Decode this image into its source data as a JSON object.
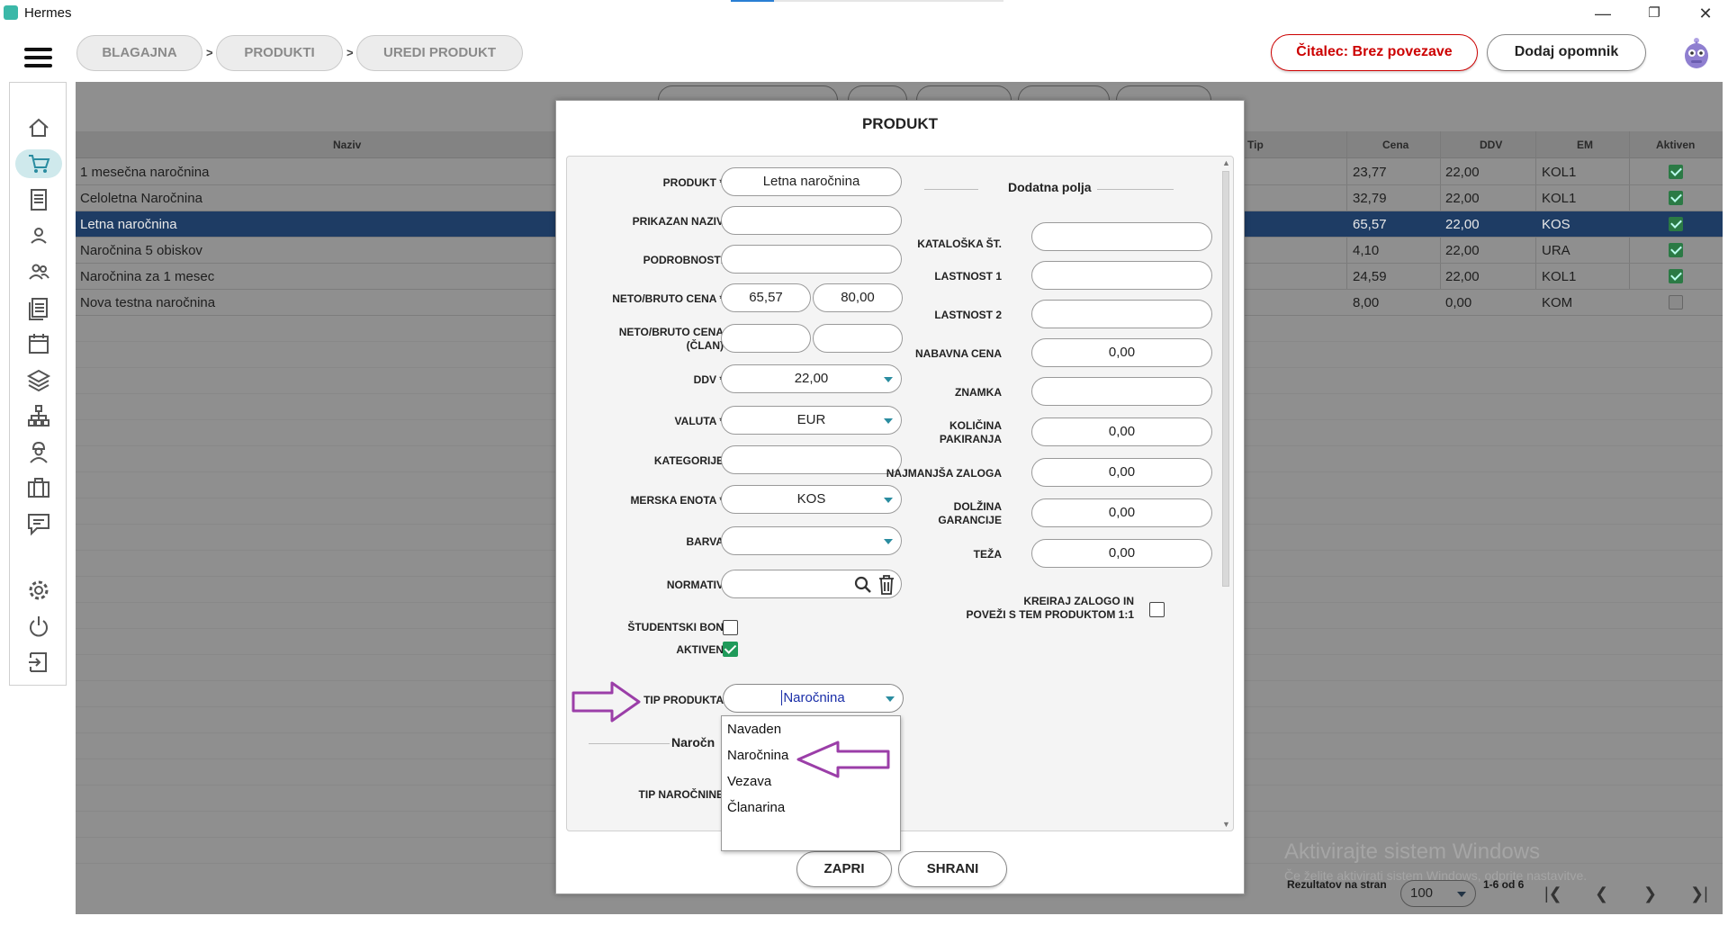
{
  "window": {
    "title": "Hermes",
    "progress_fraction": 0.16
  },
  "breadcrumb": [
    {
      "label": "BLAGAJNA"
    },
    {
      "label": "PRODUKTI"
    },
    {
      "label": "UREDI PRODUKT"
    }
  ],
  "breadcrumb_sep": ">",
  "header": {
    "reader_status": "Čitalec: Brez povezave",
    "reader_color": "#cc0000",
    "add_reminder": "Dodaj opomnik"
  },
  "sidebar": {
    "items": [
      {
        "icon": "home-icon"
      },
      {
        "icon": "cart-icon",
        "active": true
      },
      {
        "icon": "document-icon"
      },
      {
        "icon": "user-icon"
      },
      {
        "icon": "users-icon"
      },
      {
        "icon": "list-icon"
      },
      {
        "icon": "calendar-icon"
      },
      {
        "icon": "layers-icon"
      },
      {
        "icon": "network-icon"
      },
      {
        "icon": "worker-icon"
      },
      {
        "icon": "briefcase-icon"
      },
      {
        "icon": "chat-icon"
      },
      {
        "icon": "gear-icon"
      },
      {
        "icon": "power-icon"
      },
      {
        "icon": "logout-icon"
      }
    ]
  },
  "table": {
    "headers": {
      "name": "Naziv",
      "type": "Tip",
      "price": "Cena",
      "vat": "DDV",
      "unit": "EM",
      "active": "Aktiven"
    },
    "rows": [
      {
        "name": "1 mesečna naročnina",
        "price": "23,77",
        "vat": "22,00",
        "unit": "KOL1",
        "active": true
      },
      {
        "name": "Celoletna Naročnina",
        "price": "32,79",
        "vat": "22,00",
        "unit": "KOL1",
        "active": true
      },
      {
        "name": "Letna naročnina",
        "price": "65,57",
        "vat": "22,00",
        "unit": "KOS",
        "active": true,
        "selected": true
      },
      {
        "name": "Naročnina 5 obiskov",
        "price": "4,10",
        "vat": "22,00",
        "unit": "URA",
        "active": true
      },
      {
        "name": "Naročnina za 1 mesec",
        "price": "24,59",
        "vat": "22,00",
        "unit": "KOL1",
        "active": true
      },
      {
        "name": "Nova testna naročnina",
        "price": "8,00",
        "vat": "0,00",
        "unit": "KOM",
        "active": false
      }
    ]
  },
  "footer": {
    "results_per_page_label": "Rezultatov na stran",
    "results_per_page": "100",
    "range": "1-6 od 6"
  },
  "watermark": {
    "line1": "Aktivirajte sistem Windows",
    "line2": "Če želite aktivirati sistem Windows, odprite nastavitve."
  },
  "modal": {
    "title": "PRODUKT",
    "left": {
      "product_label": "PRODUKT *",
      "product_value": "Letna naročnina",
      "display_name_label": "PRIKAZAN NAZIV",
      "display_name_value": "",
      "details_label": "PODROBNOSTI",
      "details_value": "",
      "net_gross_label": "NETO/BRUTO CENA *",
      "net_value": "65,57",
      "gross_value": "80,00",
      "net_gross_member_label_1": "NETO/BRUTO CENA",
      "net_gross_member_label_2": "(ČLAN)",
      "net_member_value": "",
      "gross_member_value": "",
      "vat_label": "DDV *",
      "vat_value": "22,00",
      "currency_label": "VALUTA *",
      "currency_value": "EUR",
      "categories_label": "KATEGORIJE",
      "categories_value": "",
      "unit_label": "MERSKA ENOTA *",
      "unit_value": "KOS",
      "color_label": "BARVA",
      "color_value": "",
      "normative_label": "NORMATIV",
      "normative_value": "",
      "student_label": "ŠTUDENTSKI BON",
      "student_checked": false,
      "active_label": "AKTIVEN",
      "active_checked": true,
      "product_type_label": "TIP PRODUKTA",
      "product_type_value": "Naročnina",
      "subscription_section": "Naročn",
      "subscription_type_label": "TIP NAROČNINE"
    },
    "right": {
      "section_title": "Dodatna polja",
      "catalog_label": "KATALOŠKA ŠT.",
      "catalog_value": "",
      "prop1_label": "LASTNOST 1",
      "prop1_value": "",
      "prop2_label": "LASTNOST 2",
      "prop2_value": "",
      "purchase_label": "NABAVNA CENA",
      "purchase_value": "0,00",
      "brand_label": "ZNAMKA",
      "brand_value": "",
      "qty_label_1": "KOLIČINA",
      "qty_label_2": "PAKIRANJA",
      "qty_value": "0,00",
      "min_stock_label": "NAJMANJŠA ZALOGA",
      "min_stock_value": "0,00",
      "warranty_label_1": "DOLŽINA",
      "warranty_label_2": "GARANCIJE",
      "warranty_value": "0,00",
      "weight_label": "TEŽA",
      "weight_value": "0,00",
      "stock_link_label_1": "KREIRAJ ZALOGO IN",
      "stock_link_label_2": "POVEŽI S TEM PRODUKTOM 1:1",
      "stock_link_checked": false
    },
    "close_button": "ZAPRI",
    "save_button": "SHRANI"
  },
  "dropdown": {
    "options": [
      "Navaden",
      "Naročnina",
      "Vezava",
      "Članarina"
    ],
    "selected": "Naročnina"
  },
  "colors": {
    "accent": "#2a8ca0",
    "selected_row": "#1e3c64",
    "arrow": "#9b3ea8",
    "checked": "#1f9a5a"
  }
}
